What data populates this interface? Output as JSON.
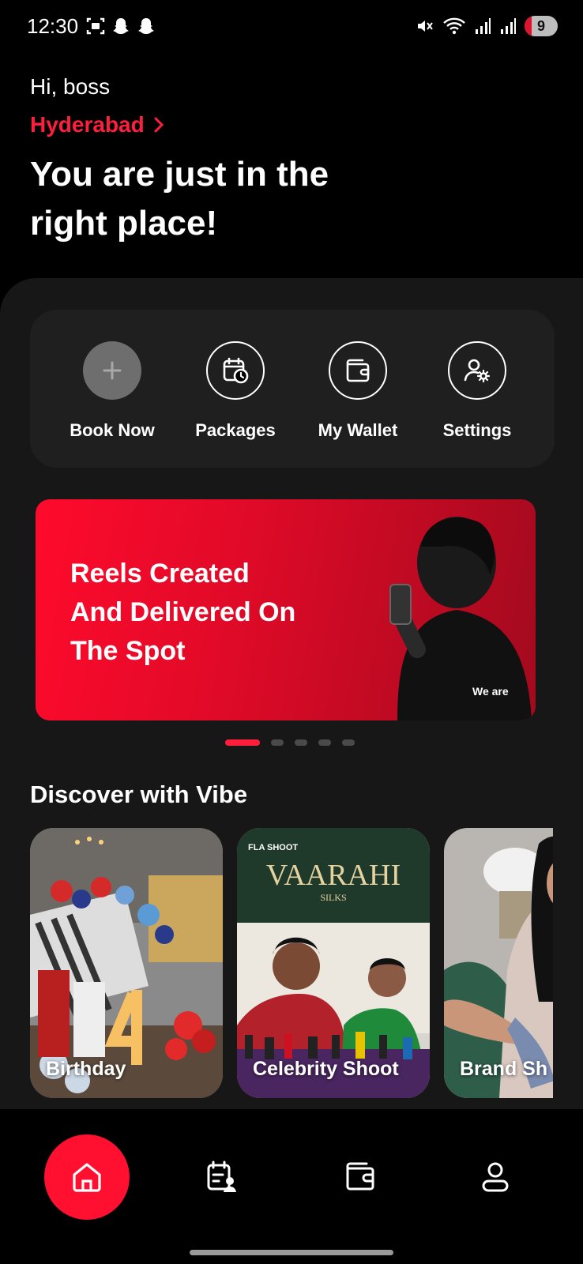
{
  "status_bar": {
    "time": "12:30",
    "battery": "9"
  },
  "header": {
    "greeting": "Hi, boss",
    "city": "Hyderabad",
    "headline": "You are just in the right place!"
  },
  "quick_actions": [
    {
      "label": "Book Now",
      "icon": "plus-icon"
    },
    {
      "label": "Packages",
      "icon": "calendar-clock-icon"
    },
    {
      "label": "My Wallet",
      "icon": "wallet-icon"
    },
    {
      "label": "Settings",
      "icon": "user-gear-icon"
    }
  ],
  "banner": {
    "text": "Reels Created And Delivered On The Spot",
    "shirt_text": "We are",
    "carousel_active_index": 0,
    "carousel_count": 5
  },
  "discover": {
    "title": "Discover with Vibe",
    "cards": [
      {
        "label": "Birthday"
      },
      {
        "label": "Celebrity Shoot",
        "sign_text": "VAARAHI",
        "sign_subtext": "SILKS",
        "logo_text": "FLA SHOOT"
      },
      {
        "label": "Brand Sh"
      }
    ]
  },
  "bottom_nav": {
    "items": [
      {
        "name": "home",
        "icon": "home-icon",
        "active": true
      },
      {
        "name": "bookings",
        "icon": "bookings-icon",
        "active": false
      },
      {
        "name": "wallet",
        "icon": "wallet-icon",
        "active": false
      },
      {
        "name": "profile",
        "icon": "profile-icon",
        "active": false
      }
    ]
  },
  "colors": {
    "accent": "#ff1f3d",
    "background": "#000000",
    "sheet": "#171717",
    "card": "#1f1f1f"
  }
}
